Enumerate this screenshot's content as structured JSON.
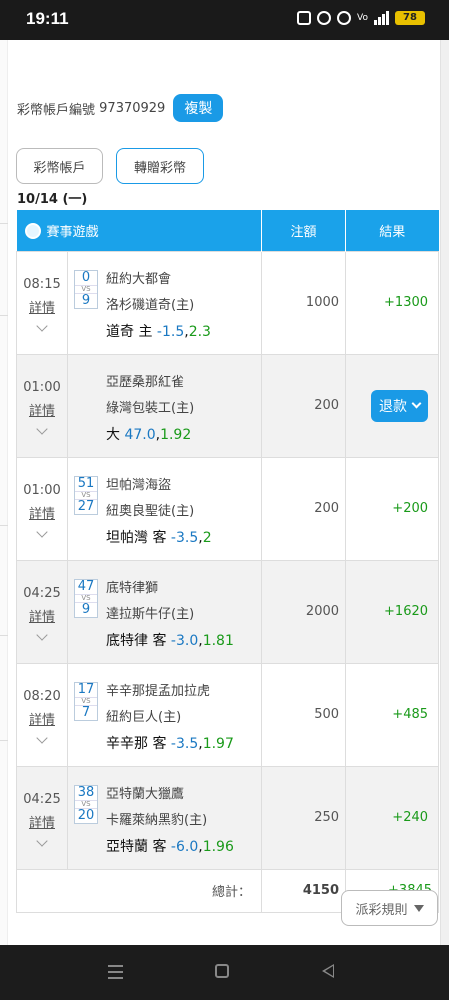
{
  "status_bar": {
    "time": "19:11",
    "battery": "78"
  },
  "account": {
    "label": "彩幣帳戶編號",
    "number": "97370929",
    "copy_label": "複製"
  },
  "tabs": [
    {
      "label": "彩幣帳戶"
    },
    {
      "label": "轉贈彩幣"
    }
  ],
  "date": "10/14 (一)",
  "table": {
    "headers": {
      "game": "賽事遊戲",
      "amount": "注額",
      "result": "結果"
    },
    "detail_label": "詳情",
    "rows": [
      {
        "time": "08:15",
        "score_away": "0",
        "score_home": "9",
        "team1": "紐約大都會",
        "team2": "洛杉磯道奇(主)",
        "pick": "道奇 主",
        "line": "-1.5",
        "sep": ",",
        "odds": "2.3",
        "amount": "1000",
        "result": "+1300"
      },
      {
        "time": "01:00",
        "score_away": "",
        "score_home": "",
        "team1": "亞歷桑那紅雀",
        "team2": "綠灣包裝工(主)",
        "pick": "大",
        "line": "47.0",
        "sep": ",",
        "odds": "1.92",
        "amount": "200",
        "result": "",
        "refund_label": "退款"
      },
      {
        "time": "01:00",
        "score_away": "51",
        "score_home": "27",
        "team1": "坦帕灣海盜",
        "team2": "紐奧良聖徒(主)",
        "pick": "坦帕灣 客",
        "line": "-3.5",
        "sep": ",",
        "odds": "2",
        "amount": "200",
        "result": "+200"
      },
      {
        "time": "04:25",
        "score_away": "47",
        "score_home": "9",
        "team1": "底特律獅",
        "team2": "達拉斯牛仔(主)",
        "pick": "底特律 客",
        "line": "-3.0",
        "sep": ",",
        "odds": "1.81",
        "amount": "2000",
        "result": "+1620"
      },
      {
        "time": "08:20",
        "score_away": "17",
        "score_home": "7",
        "team1": "辛辛那提孟加拉虎",
        "team2": "紐約巨人(主)",
        "pick": "辛辛那 客",
        "line": "-3.5",
        "sep": ",",
        "odds": "1.97",
        "amount": "500",
        "result": "+485"
      },
      {
        "time": "04:25",
        "score_away": "38",
        "score_home": "20",
        "team1": "亞特蘭大獵鷹",
        "team2": "卡羅萊納黑豹(主)",
        "pick": "亞特蘭 客",
        "line": "-6.0",
        "sep": ",",
        "odds": "1.96",
        "amount": "250",
        "result": "+240"
      }
    ],
    "total": {
      "label": "總計：",
      "amount": "4150",
      "result": "+3845"
    }
  },
  "rules_button": {
    "label": "派彩規則"
  },
  "colors": {
    "accent": "#1a9ae6",
    "win": "#1a9a1a",
    "line": "#1a78c2"
  }
}
